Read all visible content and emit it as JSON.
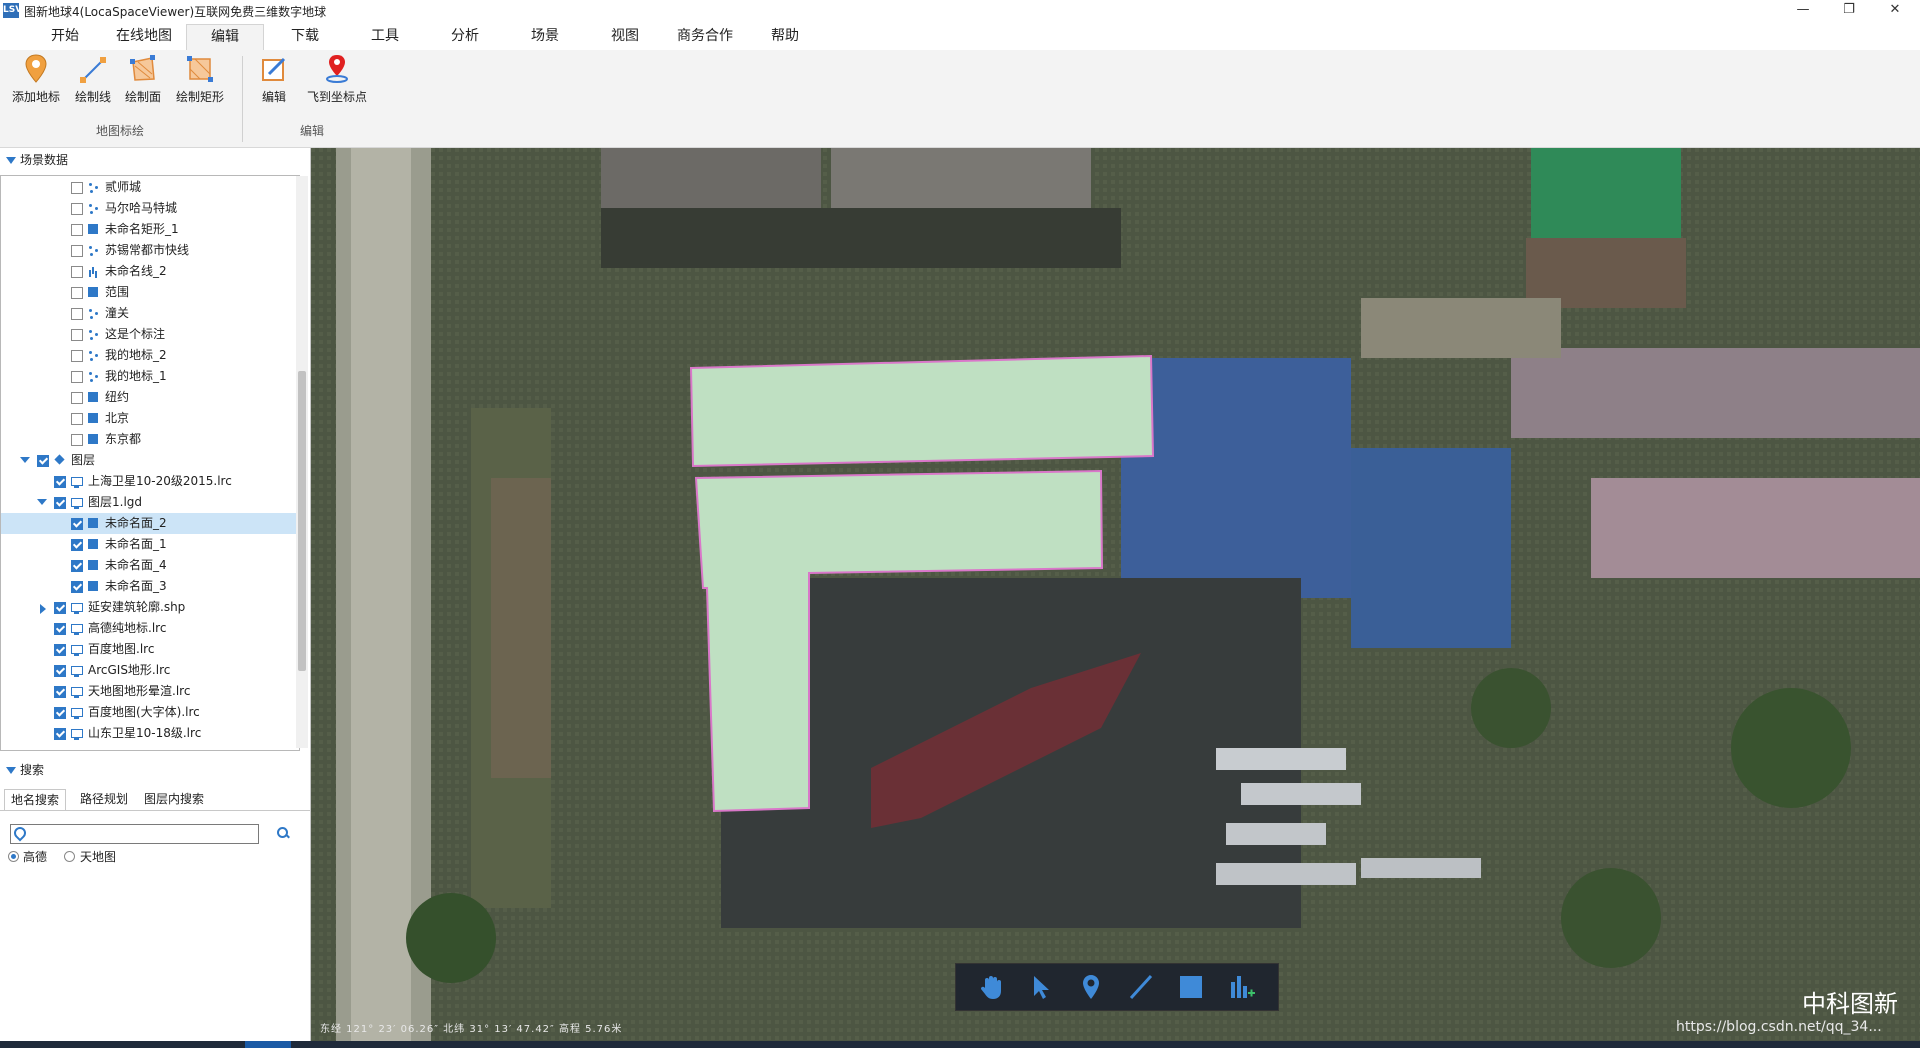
{
  "window": {
    "title": "图新地球4(LocaSpaceViewer)互联网免费三维数字地球",
    "icon_text": "LSV",
    "controls": [
      "—",
      "❐",
      "✕"
    ]
  },
  "menu": {
    "tabs": [
      "开始",
      "在线地图",
      "编辑",
      "下载",
      "工具",
      "分析",
      "场景",
      "视图",
      "商务合作",
      "帮助"
    ],
    "active": "编辑"
  },
  "ribbon": {
    "groups": [
      {
        "label": "地图标绘",
        "buttons": [
          "添加地标",
          "绘制线",
          "绘制面",
          "绘制矩形"
        ]
      },
      {
        "label": "编辑",
        "buttons": [
          "编辑",
          "飞到坐标点"
        ]
      }
    ]
  },
  "scene_panel": {
    "title": "场景数据",
    "tree": [
      {
        "label": "贰师城",
        "icon": "point-icon",
        "checked": false
      },
      {
        "label": "马尔哈马特城",
        "icon": "point-icon",
        "checked": false
      },
      {
        "label": "未命名矩形_1",
        "icon": "polygon-icon",
        "checked": false
      },
      {
        "label": "苏锡常都市快线",
        "icon": "point-icon",
        "checked": false
      },
      {
        "label": "未命名线_2",
        "icon": "line-icon",
        "checked": false
      },
      {
        "label": "范围",
        "icon": "polygon-icon",
        "checked": false
      },
      {
        "label": "潼关",
        "icon": "point-icon",
        "checked": false
      },
      {
        "label": "这是个标注",
        "icon": "point-icon",
        "checked": false
      },
      {
        "label": "我的地标_2",
        "icon": "point-icon",
        "checked": false
      },
      {
        "label": "我的地标_1",
        "icon": "point-icon",
        "checked": false
      },
      {
        "label": "纽约",
        "icon": "polygon-icon",
        "checked": false
      },
      {
        "label": "北京",
        "icon": "polygon-icon",
        "checked": false
      },
      {
        "label": "东京都",
        "icon": "polygon-icon",
        "checked": false
      },
      {
        "label": "图层",
        "icon": "layers-icon",
        "checked": true,
        "expander": "down"
      },
      {
        "label": "上海卫星10-20级2015.lrc",
        "icon": "monitor-icon",
        "checked": true
      },
      {
        "label": "图层1.lgd",
        "icon": "monitor-icon",
        "checked": true,
        "expander": "down"
      },
      {
        "label": "未命名面_2",
        "icon": "polygon-icon",
        "checked": true,
        "selected": true
      },
      {
        "label": "未命名面_1",
        "icon": "polygon-icon",
        "checked": true
      },
      {
        "label": "未命名面_4",
        "icon": "polygon-icon",
        "checked": true
      },
      {
        "label": "未命名面_3",
        "icon": "polygon-icon",
        "checked": true
      },
      {
        "label": "延安建筑轮廓.shp",
        "icon": "monitor-icon",
        "checked": true,
        "expander": "right"
      },
      {
        "label": "高德纯地标.lrc",
        "icon": "monitor-icon",
        "checked": true
      },
      {
        "label": "百度地图.lrc",
        "icon": "monitor-icon",
        "checked": true
      },
      {
        "label": "ArcGIS地形.lrc",
        "icon": "monitor-icon",
        "checked": true
      },
      {
        "label": "天地图地形晕渲.lrc",
        "icon": "monitor-icon",
        "checked": true
      },
      {
        "label": "百度地图(大字体).lrc",
        "icon": "monitor-icon",
        "checked": true
      },
      {
        "label": "山东卫星10-18级.lrc",
        "icon": "monitor-icon",
        "checked": true
      }
    ]
  },
  "search_panel": {
    "title": "搜索",
    "tabs": [
      "地名搜索",
      "路径规划",
      "图层内搜索"
    ],
    "input_value": "",
    "providers": [
      {
        "label": "高德",
        "selected": true
      },
      {
        "label": "天地图",
        "selected": false
      }
    ]
  },
  "status": {
    "coords": "东经 121°  23′  06.26″  北纬 31°  13′  47.42″    高程  5.76米",
    "url": "https://blog.csdn.net/qq_34..."
  },
  "map": {
    "brand_watermark": "中科图新",
    "tools": [
      "pan-hand-icon",
      "select-arrow-icon",
      "placemark-icon",
      "draw-line-icon",
      "draw-polygon-icon",
      "measure-chart-icon"
    ],
    "polygon_fill": "#bfe0c2",
    "polygon_stroke": "#d977c9"
  }
}
